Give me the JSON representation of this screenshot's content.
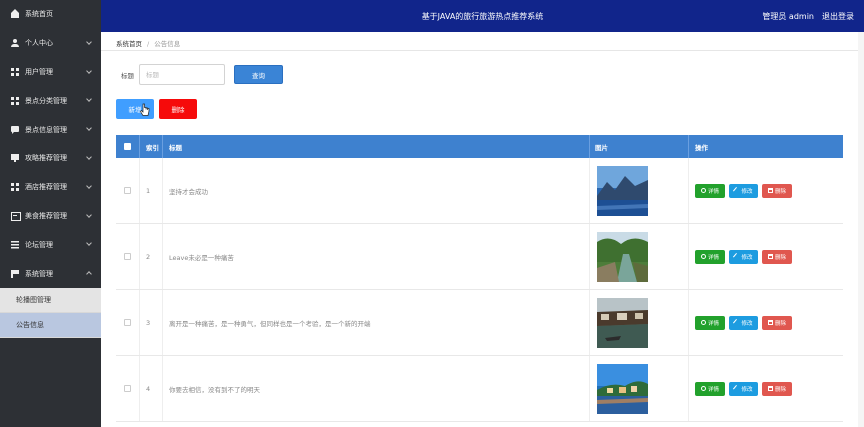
{
  "app": {
    "title": "基于JAVA的旅行旅游热点推荐系统",
    "user_label": "管理员 admin",
    "logout_label": "退出登录"
  },
  "sidebar": {
    "items": [
      {
        "label": "系统首页",
        "icon": "house-icon",
        "has_chevron": false
      },
      {
        "label": "个人中心",
        "icon": "user-icon",
        "has_chevron": true
      },
      {
        "label": "用户管理",
        "icon": "grid-icon",
        "has_chevron": true
      },
      {
        "label": "景点分类管理",
        "icon": "grid-icon",
        "has_chevron": true
      },
      {
        "label": "景点信息管理",
        "icon": "chat-icon",
        "has_chevron": true
      },
      {
        "label": "攻略推荐管理",
        "icon": "monitor-icon",
        "has_chevron": true
      },
      {
        "label": "酒店推荐管理",
        "icon": "grid-icon",
        "has_chevron": true
      },
      {
        "label": "美食推荐管理",
        "icon": "card-icon",
        "has_chevron": true
      },
      {
        "label": "论坛管理",
        "icon": "list-icon",
        "has_chevron": true
      },
      {
        "label": "系统管理",
        "icon": "flag-icon",
        "has_chevron": true,
        "expanded": true
      }
    ],
    "sub_items": [
      {
        "label": "轮播图管理",
        "active": false
      },
      {
        "label": "公告信息",
        "active": true
      }
    ]
  },
  "breadcrumb": {
    "home": "系统首页",
    "current": "公告信息"
  },
  "search": {
    "label": "标题",
    "placeholder": "标题",
    "button": "查询"
  },
  "actions": {
    "add": "新增",
    "delete": "删除"
  },
  "table": {
    "headers": {
      "index": "索引",
      "title": "标题",
      "image": "图片",
      "operations": "操作"
    },
    "row_buttons": {
      "detail": "详情",
      "edit": "修改",
      "delete": "删除"
    },
    "rows": [
      {
        "index": "1",
        "title": "坚持才会成功",
        "image": "lake-mountains"
      },
      {
        "index": "2",
        "title": "Leave未必是一种痛苦",
        "image": "canal-trees"
      },
      {
        "index": "3",
        "title": "离开是一种痛苦，是一种勇气，但同样也是一个考验，是一个新的开端",
        "image": "old-town-river"
      },
      {
        "index": "4",
        "title": "你要去相信，没有到不了的明天",
        "image": "coast-sunset"
      }
    ]
  },
  "colors": {
    "sidebar_bg": "#2d3035",
    "topbar_bg": "#11258b",
    "table_header_bg": "#3e81cf",
    "btn_add": "#409eff",
    "btn_delete": "#f60a0a",
    "btn_detail": "#22a12c",
    "btn_edit": "#1d9ce0",
    "btn_row_delete": "#e0574f"
  }
}
